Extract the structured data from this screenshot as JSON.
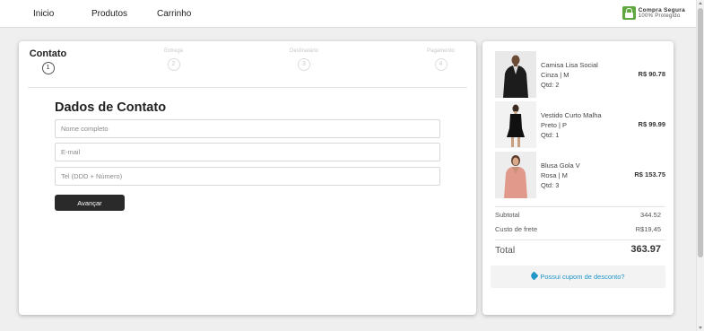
{
  "nav": {
    "items": [
      {
        "label": "Inicio"
      },
      {
        "label": "Produtos"
      },
      {
        "label": "Carrinho"
      }
    ],
    "secure": {
      "line1": "Compra Segura",
      "line2": "100% Protegido"
    }
  },
  "steps": [
    {
      "label": "Contato",
      "number": "1",
      "active": true
    },
    {
      "label": "Entrega",
      "number": "2",
      "active": false
    },
    {
      "label": "Destinatário",
      "number": "3",
      "active": false
    },
    {
      "label": "Pagamento",
      "number": "4",
      "active": false
    }
  ],
  "form": {
    "title": "Dados de Contato",
    "fields": [
      {
        "placeholder": "Nome completo",
        "value": ""
      },
      {
        "placeholder": "E-mail",
        "value": ""
      },
      {
        "placeholder": "Tel (DDD + Número)",
        "value": ""
      }
    ],
    "submit_label": "Avançar"
  },
  "summary": {
    "items": [
      {
        "name": "Camisa Lisa Social",
        "variant": "Cinza | M",
        "qty": "Qtd: 2",
        "price": "R$ 90.78",
        "image_icon": "man-in-black-suit"
      },
      {
        "name": "Vestido Curto Malha",
        "variant": "Preto | P",
        "qty": "Qtd: 1",
        "price": "R$ 99.99",
        "image_icon": "woman-in-black-dress"
      },
      {
        "name": "Blusa Gola V",
        "variant": "Rosa | M",
        "qty": "Qtd: 3",
        "price": "R$ 153.75",
        "image_icon": "woman-in-pink-blouse"
      }
    ],
    "subtotal_label": "Subtotal",
    "subtotal_value": "344.52",
    "shipping_label": "Custo de frete",
    "shipping_value": "R$19,45",
    "total_label": "Total",
    "total_value": "363.97",
    "coupon_label": "Possui cupom de desconto?"
  },
  "colors": {
    "accent": "#2196c9",
    "button": "#2a2a2a",
    "secure_green": "#5fa83f"
  }
}
